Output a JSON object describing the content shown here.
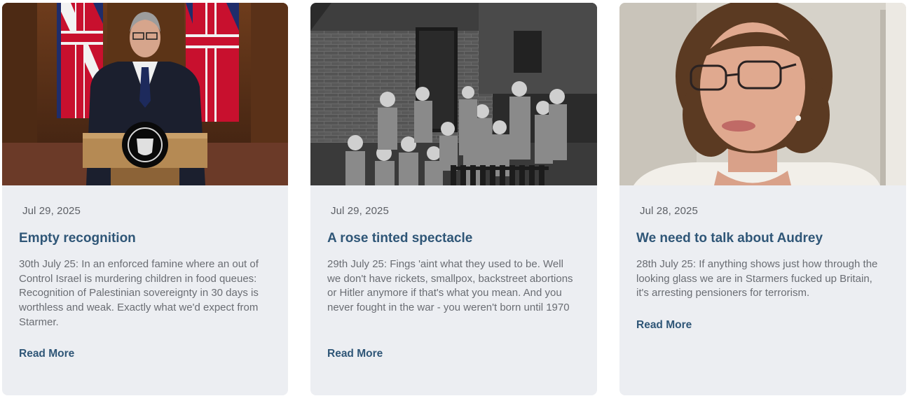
{
  "posts": [
    {
      "image_alt": "Man speaking at podium in front of Union flags",
      "date": "Jul 29, 2025",
      "title": "Empty recognition",
      "excerpt": "30th July 25: In an enforced famine where an out of Control Israel is murdering children in food queues: Recognition of Palestinian sovereignty in 30 days is worthless and weak. Exactly what we'd expect from Starmer.",
      "read_more": "Read More"
    },
    {
      "image_alt": "Black and white photo of a group of children in front of a brick house",
      "date": "Jul 29, 2025",
      "title": "A rose tinted spectacle",
      "excerpt": "29th July 25: Fings 'aint what they used to be. Well we don't have rickets, smallpox, backstreet abortions or Hitler anymore if that's what you mean. And you never fought in the war - you weren't born until 1970",
      "read_more": "Read More"
    },
    {
      "image_alt": "Older woman with glasses on a video call",
      "date": "Jul 28, 2025",
      "title": "We need to talk about Audrey",
      "excerpt": "28th July 25: If anything shows just how through the looking glass we are in Starmers fucked up Britain, it's arresting pensioners for terrorism.",
      "read_more": "Read More"
    }
  ]
}
